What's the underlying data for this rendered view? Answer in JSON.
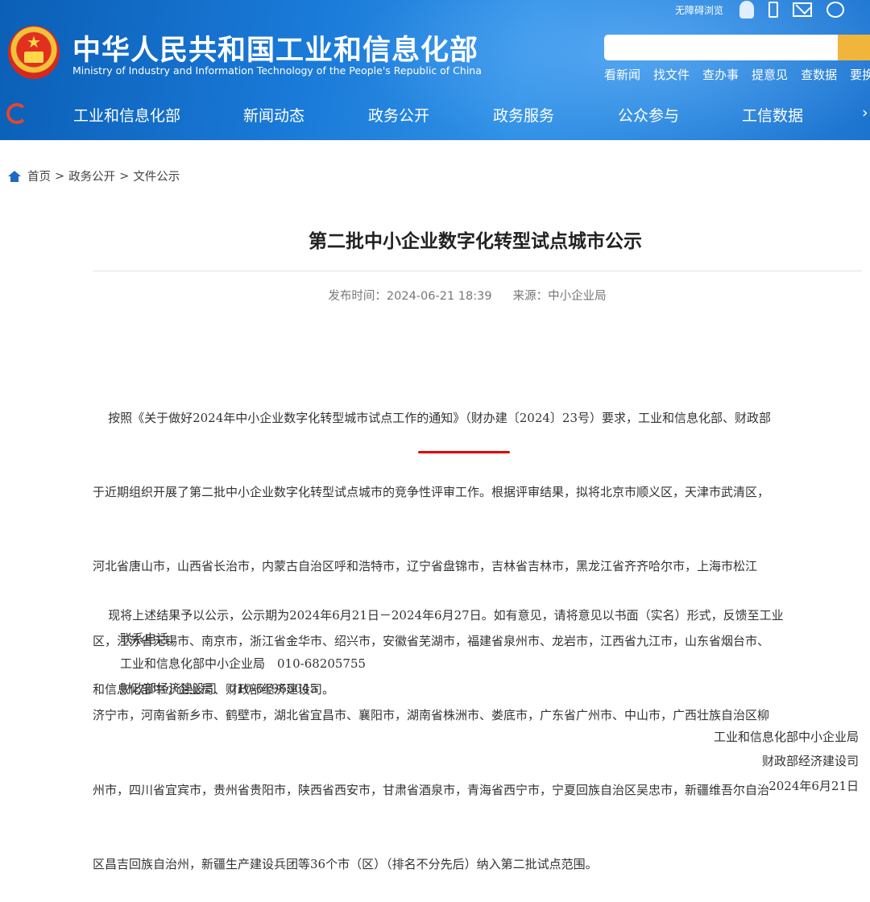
{
  "header": {
    "title_cn": "中华人民共和国工业和信息化部",
    "title_en": "Ministry of Industry and Information Technology of the People's Republic of China",
    "toolbar": {
      "accessibility": "无障碍浏览"
    },
    "search": {
      "placeholder": ""
    },
    "quick_links": [
      "看新闻",
      "找文件",
      "查办事",
      "提意见",
      "查数据",
      "要换"
    ]
  },
  "nav": {
    "items": [
      "工业和信息化部",
      "新闻动态",
      "政务公开",
      "政务服务",
      "公众参与",
      "工信数据"
    ]
  },
  "breadcrumb": [
    "首页",
    "政务公开",
    "文件公示"
  ],
  "article": {
    "title": "第二批中小企业数字化转型试点城市公示",
    "publish_time": "发布时间：2024-06-21 18:39",
    "source": "来源：中小企业局",
    "paragraph1_lines": [
      "    按照《关于做好2024年中小企业数字化转型城市试点工作的通知》（财办建〔2024〕23号）要求，工业和信息化部、财政部",
      "于近期组织开展了第二批中小企业数字化转型试点城市的竞争性评审工作。根据评审结果，拟将北京市顺义区，天津市武清区，",
      "河北省唐山市，山西省长治市，内蒙古自治区呼和浩特市，辽宁省盘锦市，吉林省吉林市，黑龙江省齐齐哈尔市，上海市松江",
      "区，江苏省无锡市、南京市，浙江省金华市、绍兴市，安徽省芜湖市，福建省泉州市、龙岩市，江西省九江市，山东省烟台市、",
      "济宁市，河南省新乡市、鹤壁市，湖北省宜昌市、襄阳市，湖南省株洲市、娄底市，广东省广州市、中山市，广西壮族自治区柳",
      "州市，四川省宜宾市，贵州省贵阳市，陕西省西安市，甘肃省酒泉市，青海省西宁市，宁夏回族自治区吴忠市，新疆维吾尔自治",
      "区昌吉回族自治州，新疆生产建设兵团等36个市（区）（排名不分先后）纳入第二批试点范围。"
    ],
    "paragraph2_lines": [
      "    现将上述结果予以公示，公示期为2024年6月21日－2024年6月27日。如有意见，请将意见以书面（实名）形式，反馈至工业",
      "和信息化部中小企业局、财政部经济建设司。"
    ],
    "contact_label": "联系电话：",
    "contact_lines": [
      "工业和信息化部中小企业局　010-68205755",
      "财政部经济建设司　010-61965045"
    ],
    "signature": [
      "工业和信息化部中小企业局",
      "财政部经济建设司",
      "2024年6月21日"
    ]
  },
  "colors": {
    "header_blue": "#1a7ad8",
    "search_button": "#f2b53b",
    "highlight_underline": "#e00000"
  }
}
